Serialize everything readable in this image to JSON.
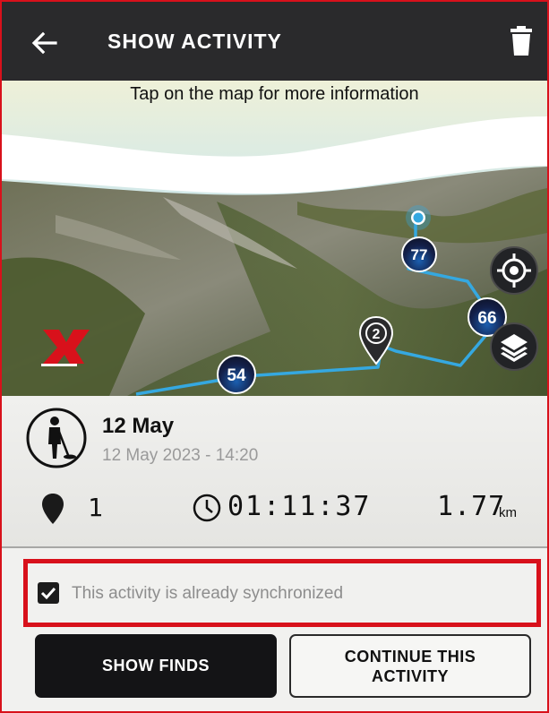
{
  "header": {
    "title": "SHOW ACTIVITY",
    "back_icon": "arrow-left-icon",
    "delete_icon": "trash-icon"
  },
  "map": {
    "hint": "Tap on the map for more information",
    "markers": [
      "77",
      "66",
      "54"
    ],
    "find_pin_label": "2",
    "buttons": [
      "locate-icon",
      "layers-icon"
    ],
    "track_color": "#35a8e0"
  },
  "activity": {
    "name": "12 May",
    "datetime": "12 May 2023 - 14:20",
    "finds_count": "1",
    "duration": "01:11:37",
    "distance": "1.77",
    "distance_unit": "km"
  },
  "sync": {
    "checked": true,
    "label": "This activity is already synchronized"
  },
  "actions": {
    "show_finds": "SHOW FINDS",
    "continue": "CONTINUE THIS\nACTIVITY"
  },
  "colors": {
    "header_bg": "#2a2a2c",
    "highlight_red": "#d8111b",
    "marker_blue": "#1b5fb0"
  }
}
